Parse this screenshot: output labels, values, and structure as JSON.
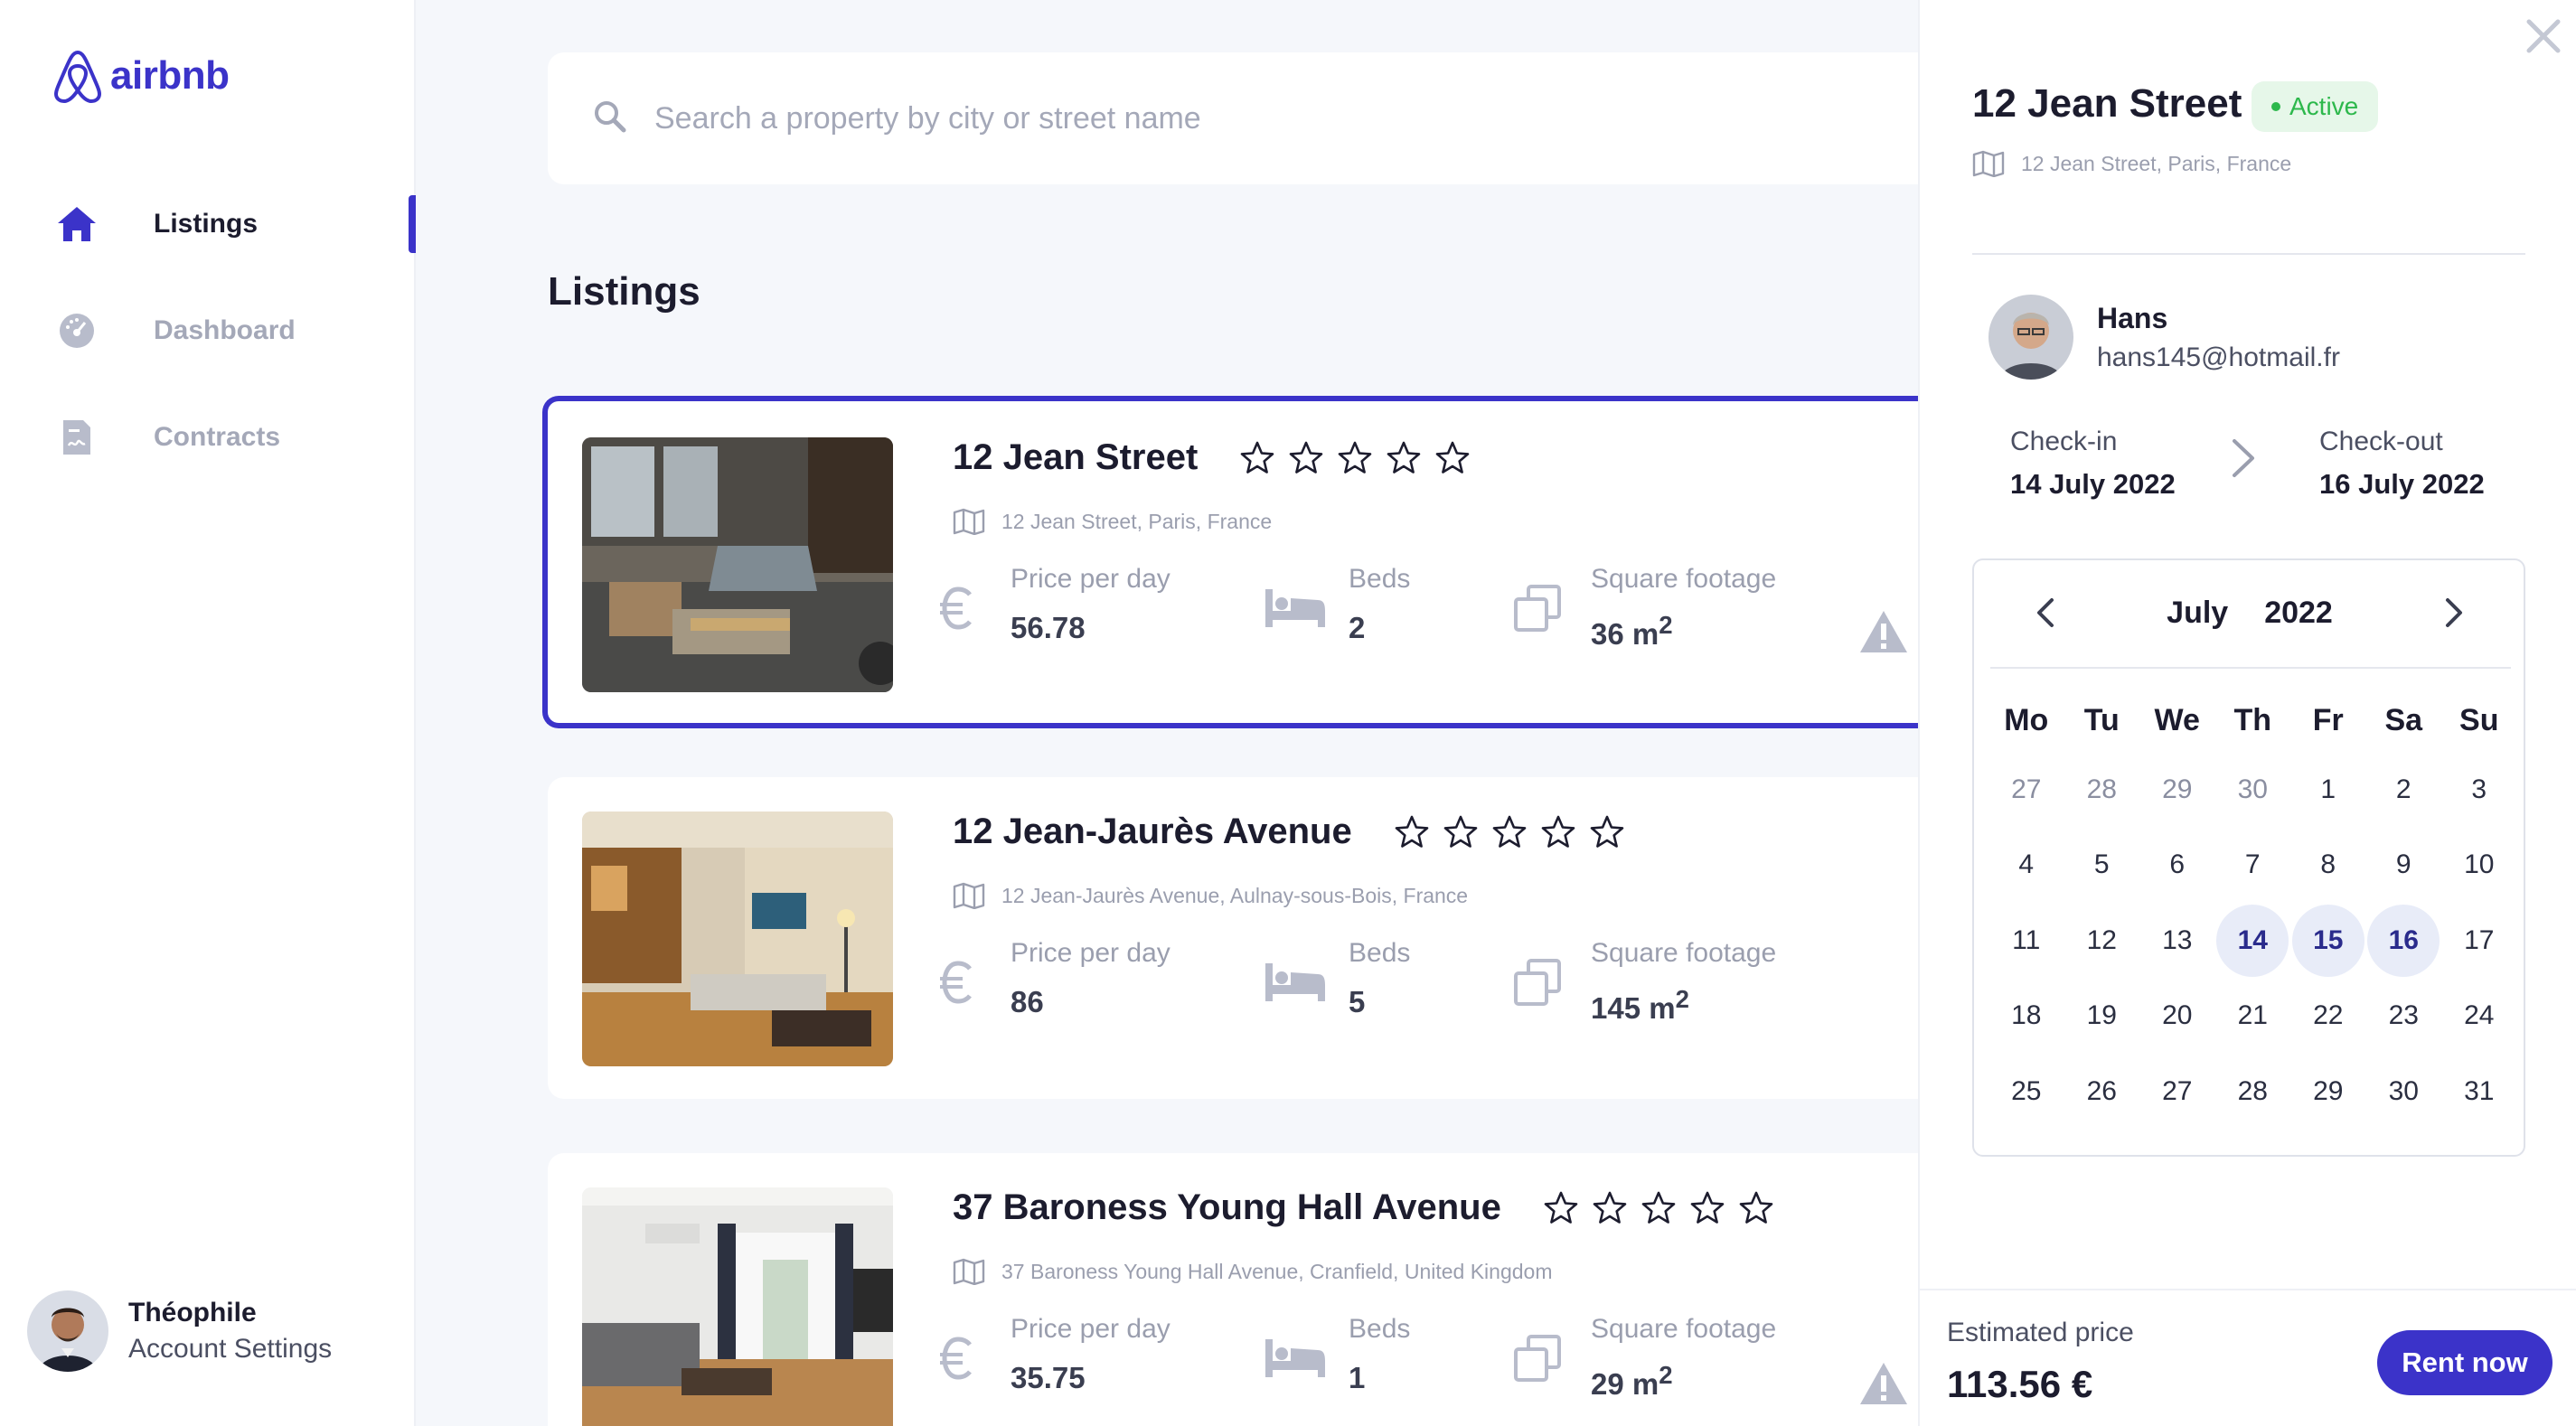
{
  "brand": {
    "name": "airbnb",
    "color": "#3b33c9"
  },
  "sidebar": {
    "items": [
      {
        "label": "Listings",
        "icon": "home-icon",
        "active": true
      },
      {
        "label": "Dashboard",
        "icon": "dashboard-gauge-icon",
        "active": false
      },
      {
        "label": "Contracts",
        "icon": "contract-document-icon",
        "active": false
      }
    ],
    "account": {
      "name": "Théophile",
      "subtitle": "Account Settings"
    }
  },
  "search": {
    "placeholder": "Search a property by city or street name",
    "value": ""
  },
  "main": {
    "title": "Listings",
    "listings": [
      {
        "title": "12 Jean  Street",
        "address": "12 Jean  Street, Paris, France",
        "rating": 0,
        "price_label": "Price per day",
        "price": "56.78",
        "beds_label": "Beds",
        "beds": "2",
        "area_label": "Square footage",
        "area": "36 m",
        "area_sup": "2",
        "selected": true,
        "warning": true
      },
      {
        "title": "12 Jean-Jaurès Avenue",
        "address": "12 Jean-Jaurès Avenue, Aulnay-sous-Bois, France",
        "rating": 0,
        "price_label": "Price per day",
        "price": "86",
        "beds_label": "Beds",
        "beds": "5",
        "area_label": "Square footage",
        "area": "145 m",
        "area_sup": "2",
        "selected": false,
        "warning": false
      },
      {
        "title": "37 Baroness Young Hall Avenue",
        "address": "37 Baroness Young Hall Avenue, Cranfield, United Kingdom",
        "rating": 0,
        "price_label": "Price per day",
        "price": "35.75",
        "beds_label": "Beds",
        "beds": "1",
        "area_label": "Square footage",
        "area": "29 m",
        "area_sup": "2",
        "selected": false,
        "warning": true
      }
    ]
  },
  "detail": {
    "title": "12 Jean Street",
    "status": "Active",
    "address": "12 Jean Street, Paris, France",
    "host": {
      "name": "Hans",
      "email": "hans145@hotmail.fr"
    },
    "checkin": {
      "label": "Check-in",
      "date": "14 July 2022"
    },
    "checkout": {
      "label": "Check-out",
      "date": "16 July 2022"
    },
    "calendar": {
      "month": "July",
      "year": "2022",
      "weekdays": [
        "Mo",
        "Tu",
        "We",
        "Th",
        "Fr",
        "Sa",
        "Su"
      ],
      "days": [
        [
          "27",
          "28",
          "29",
          "30",
          "1",
          "2",
          "3"
        ],
        [
          "4",
          "5",
          "6",
          "7",
          "8",
          "9",
          "10"
        ],
        [
          "11",
          "12",
          "13",
          "14",
          "15",
          "16",
          "17"
        ],
        [
          "18",
          "19",
          "20",
          "21",
          "22",
          "23",
          "24"
        ],
        [
          "25",
          "26",
          "27",
          "28",
          "29",
          "30",
          "31"
        ]
      ],
      "muted_prev": [
        "27",
        "28",
        "29",
        "30"
      ],
      "selected": [
        "14",
        "15",
        "16"
      ]
    },
    "estimate_label": "Estimated price",
    "estimate_value": "113.56 €",
    "rent_label": "Rent now"
  },
  "colors": {
    "accent": "#3b33c9",
    "active_green": "#2db84c",
    "selected_day_bg": "#e8ecf8"
  }
}
